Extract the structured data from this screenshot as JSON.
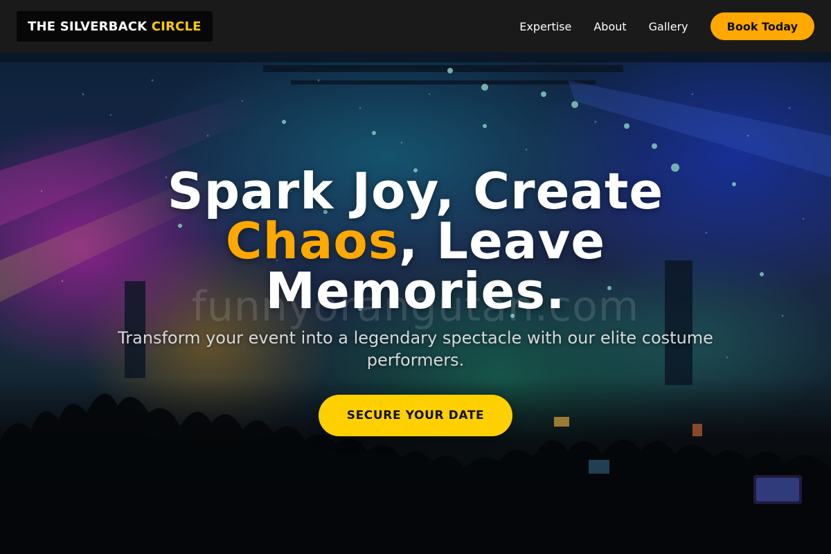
{
  "brand": {
    "name_part1": "THE SILVERBACK",
    "name_part2": "CIRCLE"
  },
  "nav": {
    "links": [
      "Expertise",
      "About",
      "Gallery"
    ],
    "cta_label": "Book Today"
  },
  "hero": {
    "headline_line1": "Spark Joy, Create",
    "headline_accent": "Chaos",
    "headline_line2_rest": ", Leave",
    "headline_line3": "Memories.",
    "subtitle": "Transform your event into a legendary spectacle with our elite costume performers.",
    "cta_label": "SECURE YOUR DATE",
    "watermark": "funnyorangutan.com",
    "background_image": "concert-crowd-confetti-stage-lights"
  },
  "colors": {
    "accent_orange": "#ffa800",
    "accent_yellow": "#ffd000",
    "logo_yellow": "#ffcc00",
    "nav_background": "#1a1a1a"
  }
}
